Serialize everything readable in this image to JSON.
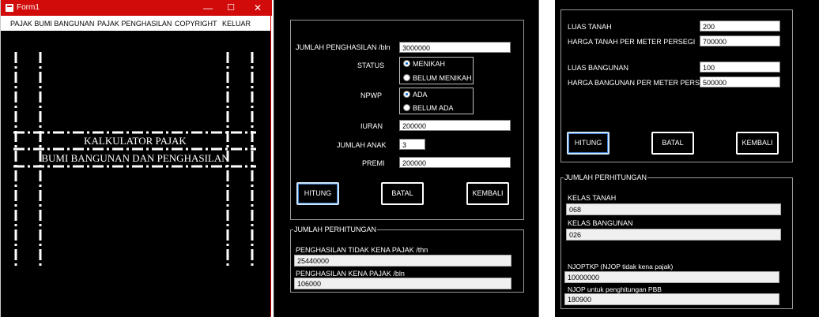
{
  "form1": {
    "title": "Form1",
    "controls": {
      "minimize": "—",
      "maximize": "☐",
      "close": "✕"
    },
    "menu": [
      "PAJAK BUMI BANGUNAN",
      "PAJAK PENGHASILAN",
      "COPYRIGHT",
      "KELUAR"
    ],
    "banner": {
      "line1": "KALKULATOR PAJAK",
      "line2": "BUMI BANGUNAN DAN PENGHASILAN"
    }
  },
  "pph": {
    "fields": {
      "penghasilan_label": "JUMLAH PENGHASILAN /bln",
      "penghasilan_value": "3000000",
      "status_label": "STATUS",
      "status_options": [
        "MENIKAH",
        "BELUM MENIKAH"
      ],
      "status_selected": "MENIKAH",
      "npwp_label": "NPWP",
      "npwp_options": [
        "ADA",
        "BELUM ADA"
      ],
      "npwp_selected": "ADA",
      "iuran_label": "IURAN",
      "iuran_value": "200000",
      "anak_label": "JUMLAH ANAK",
      "anak_value": "3",
      "premi_label": "PREMI",
      "premi_value": "200000"
    },
    "buttons": {
      "hitung": "HITUNG",
      "batal": "BATAL",
      "kembali": "KEMBALI"
    },
    "result": {
      "title": "JUMLAH PERHITUNGAN",
      "ptkp_label": "PENGHASILAN TIDAK KENA PAJAK /thn",
      "ptkp_value": "25440000",
      "pkp_label": "PENGHASILAN KENA PAJAK /bln",
      "pkp_value": "106000"
    }
  },
  "pbb": {
    "fields": {
      "luas_tanah_label": "LUAS TANAH",
      "luas_tanah_value": "200",
      "harga_tanah_label": "HARGA TANAH PER METER PERSEGI",
      "harga_tanah_value": "700000",
      "luas_bangunan_label": "LUAS BANGUNAN",
      "luas_bangunan_value": "100",
      "harga_bangunan_label": "HARGA BANGUNAN PER METER PERSEGI",
      "harga_bangunan_value": "500000"
    },
    "buttons": {
      "hitung": "HITUNG",
      "batal": "BATAL",
      "kembali": "KEMBALI"
    },
    "result": {
      "title": "JUMLAH PERHITUNGAN",
      "kelas_tanah_label": "KELAS TANAH",
      "kelas_tanah_value": "068",
      "kelas_bangunan_label": "KELAS BANGUNAN",
      "kelas_bangunan_value": "026",
      "njoptkp_label": "NJOPTKP (NJOP tidak kena pajak)",
      "njoptkp_value": "10000000",
      "njop_label": "NJOP  untuk penghitungan PBB",
      "njop_value": "180900"
    }
  },
  "colors": {
    "titlebar": "#d10a0a",
    "background": "#000000",
    "radio_accent": "#0066cc",
    "focus_border": "#3c7fd2"
  }
}
